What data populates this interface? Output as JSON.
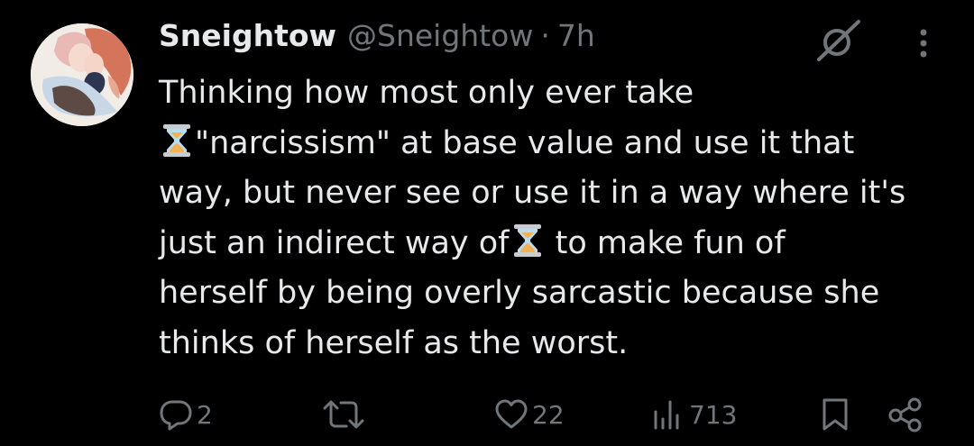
{
  "tweet": {
    "author": {
      "display_name": "Sneightow",
      "handle": "@Sneightow",
      "separator": "·",
      "time": "7h"
    },
    "text_lines": [
      {
        "before": "Thinking how most only ever take",
        "emoji": false,
        "after": ""
      },
      {
        "before": "",
        "emoji": true,
        "after": "\"narcissism\" at base value and use it that"
      },
      {
        "before": "way, but never see or use it in a way where it's",
        "emoji": false,
        "after": ""
      },
      {
        "before": "just an indirect way of",
        "emoji": true,
        "after": " to make fun of"
      },
      {
        "before": "herself by being overly sarcastic because she",
        "emoji": false,
        "after": ""
      },
      {
        "before": "thinks of herself as the worst.",
        "emoji": false,
        "after": ""
      }
    ],
    "emoji_name": "hourglass-done",
    "header_icons": [
      "grok-icon",
      "more-icon"
    ],
    "actions": {
      "replies": "2",
      "retweets": "",
      "likes": "22",
      "views": "713",
      "icons": [
        "reply-icon",
        "retweet-icon",
        "like-icon",
        "views-icon",
        "bookmark-icon",
        "share-icon"
      ]
    }
  },
  "colors": {
    "background": "#000000",
    "primary_text": "#e7e9ea",
    "secondary_text": "#71767b"
  }
}
